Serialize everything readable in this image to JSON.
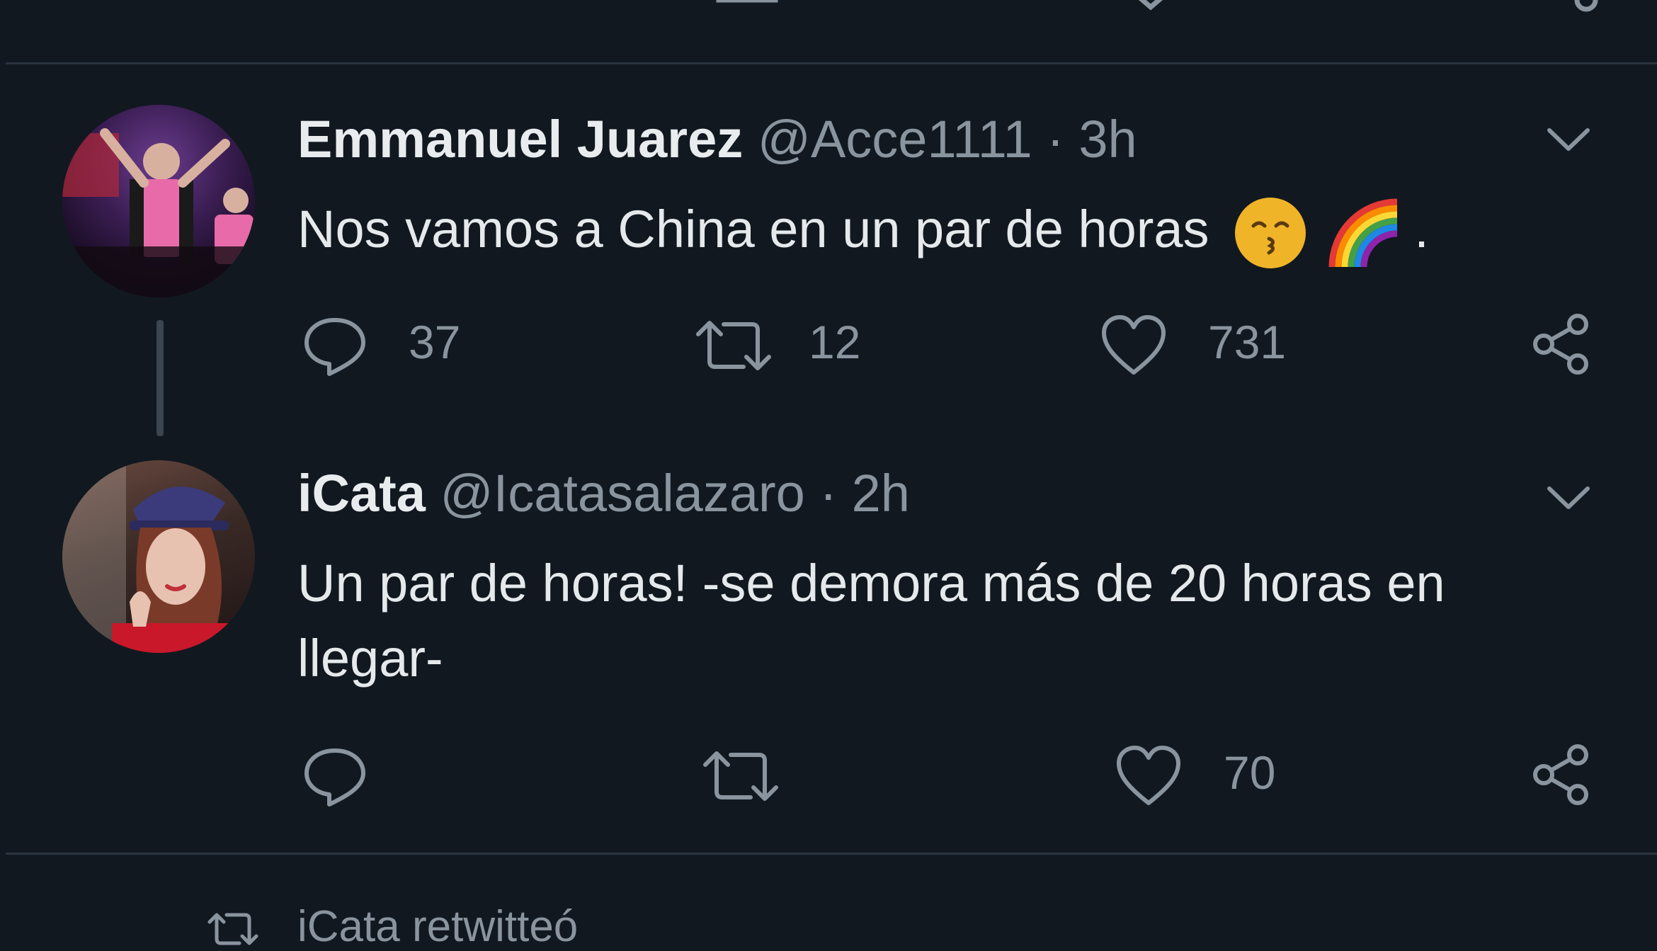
{
  "tweets": [
    {
      "name": "Emmanuel Juarez",
      "handle": "@Acce1111",
      "separator": "·",
      "time": "3h",
      "text": "Nos vamos a China en un par de horas",
      "trailing": ".",
      "emojis": [
        "kissing-face-emoji",
        "rainbow-emoji"
      ],
      "replies": "37",
      "retweets": "12",
      "likes": "731"
    },
    {
      "name": "iCata",
      "handle": "@Icatasalazaro",
      "separator": "·",
      "time": "2h",
      "text_line1": "Un par de horas! -se demora más de 20 horas en",
      "text_line2": "llegar-",
      "replies": "",
      "retweets": "",
      "likes": "70"
    }
  ],
  "retweet_banner": {
    "label": "iCata retwitteó"
  },
  "colors": {
    "background": "#111820",
    "divider": "#2a343e",
    "muted": "#8a949e",
    "text": "#e6e9ec"
  },
  "icons": [
    "reply-icon",
    "retweet-icon",
    "like-icon",
    "share-icon",
    "chevron-down-icon"
  ]
}
